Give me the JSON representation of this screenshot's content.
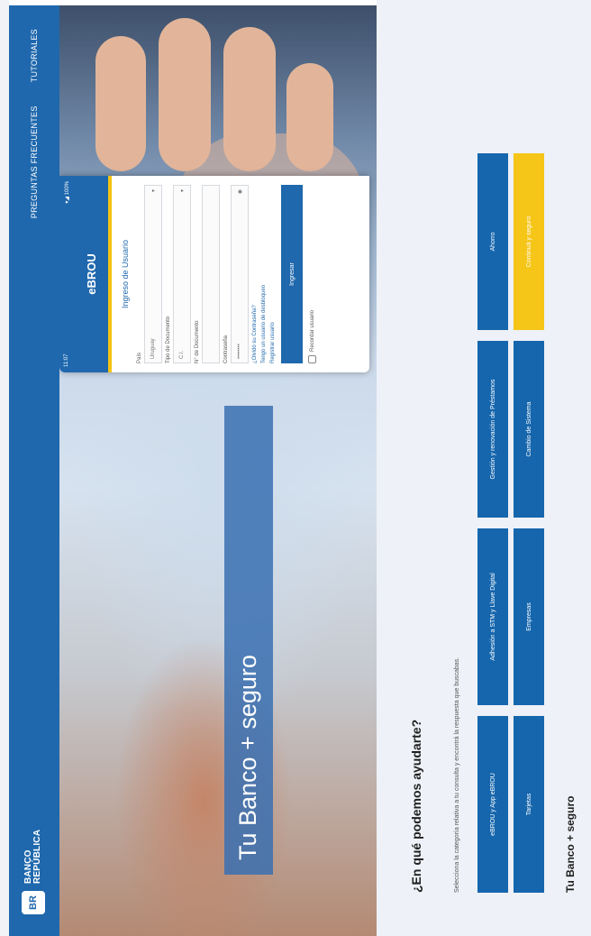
{
  "header": {
    "logo_line1": "BANCO",
    "logo_line2": "REPÚBLICA",
    "logo_mark": "BR",
    "nav": [
      "PREGUNTAS FRECUENTES",
      "TUTORIALES"
    ]
  },
  "hero": {
    "title": "Tu Banco + seguro",
    "phone": {
      "status_time": "11:07",
      "status_icons": "▾◢ 100%",
      "brand": "eBROU",
      "heading": "Ingreso de Usuario",
      "fields": [
        {
          "label": "País",
          "value": "Uruguay"
        },
        {
          "label": "Tipo de Documento",
          "value": "C.I."
        },
        {
          "label": "N° de Documento",
          "value": ""
        },
        {
          "label": "Contraseña",
          "value": "••••••••"
        }
      ],
      "links": [
        "¿Olvidó su Contraseña?",
        "Tengo un usuario de desbloqueo",
        "Registrar usuario"
      ],
      "button": "Ingresar",
      "remember": "Recordar usuario"
    }
  },
  "help": {
    "title": "¿En qué podemos ayudarte?",
    "subtitle": "Selecciona la categoría relativa a tu consulta y encontrá la respuesta que buscabas.",
    "categories_row1": [
      "eBROU y App eBROU",
      "Adhesión a STM y Llave Digital",
      "Gestión y renovación de Préstamos",
      "Ahorro"
    ],
    "categories_row2": [
      "Tarjetas",
      "Empresas",
      "Cambio de Sistema",
      "Continuá y seguro"
    ],
    "bottom_title": "Tu Banco + seguro"
  },
  "colors": {
    "brand_blue": "#1f68ad",
    "accent_yellow": "#f5c518",
    "section_bg": "#eef1f7"
  }
}
